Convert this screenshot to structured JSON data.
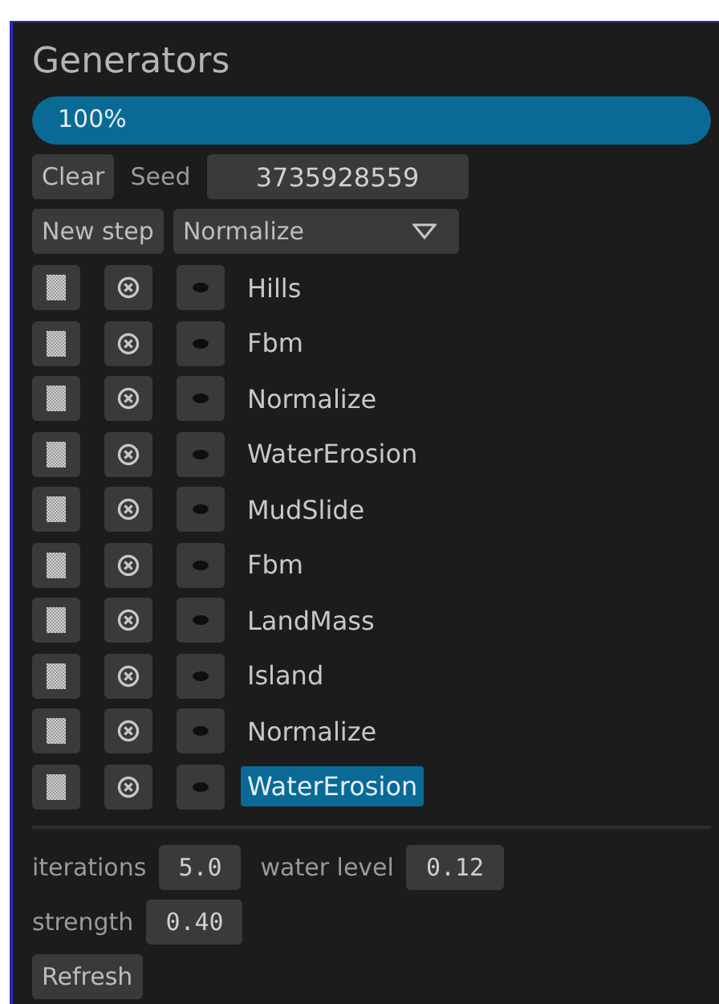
{
  "title": "Generators",
  "progress": {
    "level": 1.0,
    "label": "100%"
  },
  "clear_button": "Clear",
  "seed": {
    "label": "Seed",
    "value": "3735928559"
  },
  "new_step_button": "New step",
  "step_type": {
    "value": "Normalize"
  },
  "steps": [
    {
      "name": "Hills",
      "selected": false
    },
    {
      "name": "Fbm",
      "selected": false
    },
    {
      "name": "Normalize",
      "selected": false
    },
    {
      "name": "WaterErosion",
      "selected": false
    },
    {
      "name": "MudSlide",
      "selected": false
    },
    {
      "name": "Fbm",
      "selected": false
    },
    {
      "name": "LandMass",
      "selected": false
    },
    {
      "name": "Island",
      "selected": false
    },
    {
      "name": "Normalize",
      "selected": false
    },
    {
      "name": "WaterErosion",
      "selected": true
    }
  ],
  "params": [
    [
      {
        "label": "iterations",
        "value": "5.0"
      },
      {
        "label": "water level",
        "value": "0.12"
      }
    ],
    [
      {
        "label": "strength",
        "value": "0.40"
      }
    ]
  ],
  "refresh_button": "Refresh"
}
